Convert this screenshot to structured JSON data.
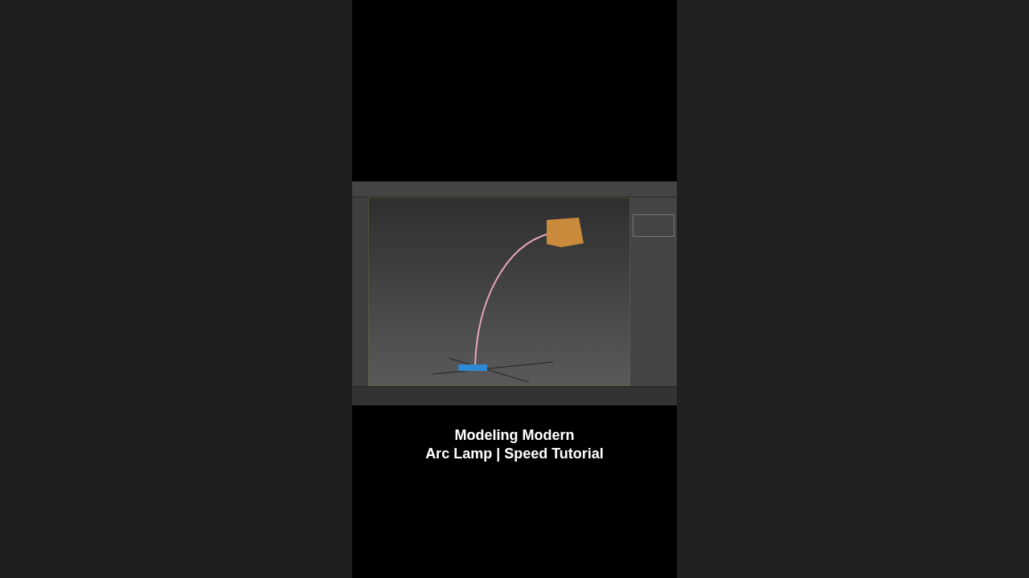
{
  "caption": {
    "lines": [
      "Modeling Modern",
      "Arc Lamp | Speed Tutorial"
    ]
  }
}
